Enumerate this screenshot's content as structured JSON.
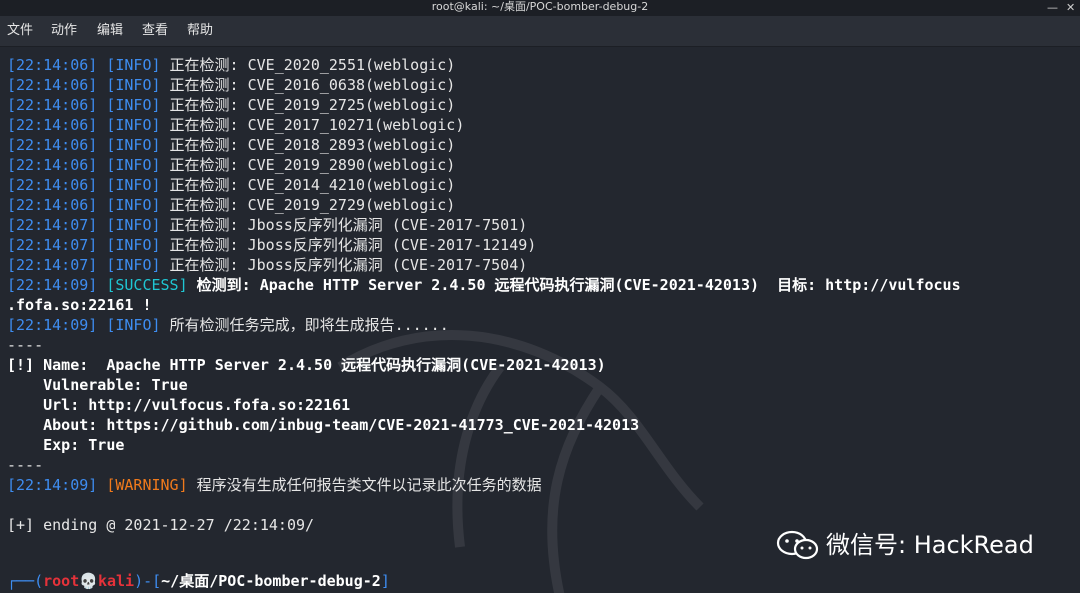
{
  "window": {
    "title": "root@kali: ~/桌面/POC-bomber-debug-2"
  },
  "menu": [
    "文件",
    "动作",
    "编辑",
    "查看",
    "帮助"
  ],
  "lines": [
    {
      "ts": "[22:14:06]",
      "tag": "[INFO]",
      "text": " 正在检测: CVE_2020_2551(weblogic)"
    },
    {
      "ts": "[22:14:06]",
      "tag": "[INFO]",
      "text": " 正在检测: CVE_2016_0638(weblogic)"
    },
    {
      "ts": "[22:14:06]",
      "tag": "[INFO]",
      "text": " 正在检测: CVE_2019_2725(weblogic)"
    },
    {
      "ts": "[22:14:06]",
      "tag": "[INFO]",
      "text": " 正在检测: CVE_2017_10271(weblogic)"
    },
    {
      "ts": "[22:14:06]",
      "tag": "[INFO]",
      "text": " 正在检测: CVE_2018_2893(weblogic)"
    },
    {
      "ts": "[22:14:06]",
      "tag": "[INFO]",
      "text": " 正在检测: CVE_2019_2890(weblogic)"
    },
    {
      "ts": "[22:14:06]",
      "tag": "[INFO]",
      "text": " 正在检测: CVE_2014_4210(weblogic)"
    },
    {
      "ts": "[22:14:06]",
      "tag": "[INFO]",
      "text": " 正在检测: CVE_2019_2729(weblogic)"
    },
    {
      "ts": "[22:14:07]",
      "tag": "[INFO]",
      "text": " 正在检测: Jboss反序列化漏洞 (CVE-2017-7501)"
    },
    {
      "ts": "[22:14:07]",
      "tag": "[INFO]",
      "text": " 正在检测: Jboss反序列化漏洞 (CVE-2017-12149)"
    },
    {
      "ts": "[22:14:07]",
      "tag": "[INFO]",
      "text": " 正在检测: Jboss反序列化漏洞 (CVE-2017-7504)"
    }
  ],
  "success": {
    "ts": "[22:14:09]",
    "tag": "[SUCCESS]",
    "text": " 检测到: Apache HTTP Server 2.4.50 远程代码执行漏洞(CVE-2021-42013)  目标: http://vulfocus",
    "cont": ".fofa.so:22161 !"
  },
  "done": {
    "ts": "[22:14:09]",
    "tag": "[INFO]",
    "text": " 所有检测任务完成，即将生成报告......"
  },
  "sep1": "----",
  "result": {
    "name": "[!] Name:  Apache HTTP Server 2.4.50 远程代码执行漏洞(CVE-2021-42013)",
    "vulnerable": "    Vulnerable: True",
    "url": "    Url: http://vulfocus.fofa.so:22161",
    "about": "    About: https://github.com/inbug-team/CVE-2021-41773_CVE-2021-42013",
    "exp": "    Exp: True"
  },
  "sep2": "----",
  "warning": {
    "ts": "[22:14:09]",
    "tag": "[WARNING]",
    "text": " 程序没有生成任何报告类文件以记录此次任务的数据"
  },
  "ending": "[+] ending @ 2021-12-27 /22:14:09/",
  "prompt": {
    "prefix": "┌──(",
    "user": "root",
    "skull": "💀",
    "host": "kali",
    "mid": ")-[",
    "path": "~/桌面/POC-bomber-debug-2",
    "suffix": "]"
  },
  "watermark": "微信号: HackRead",
  "colors": {
    "timestamp": "#3e8df1",
    "success": "#1fc6d3",
    "warning": "#f07a1c",
    "user": "#e5323a",
    "background": "#23272f"
  }
}
